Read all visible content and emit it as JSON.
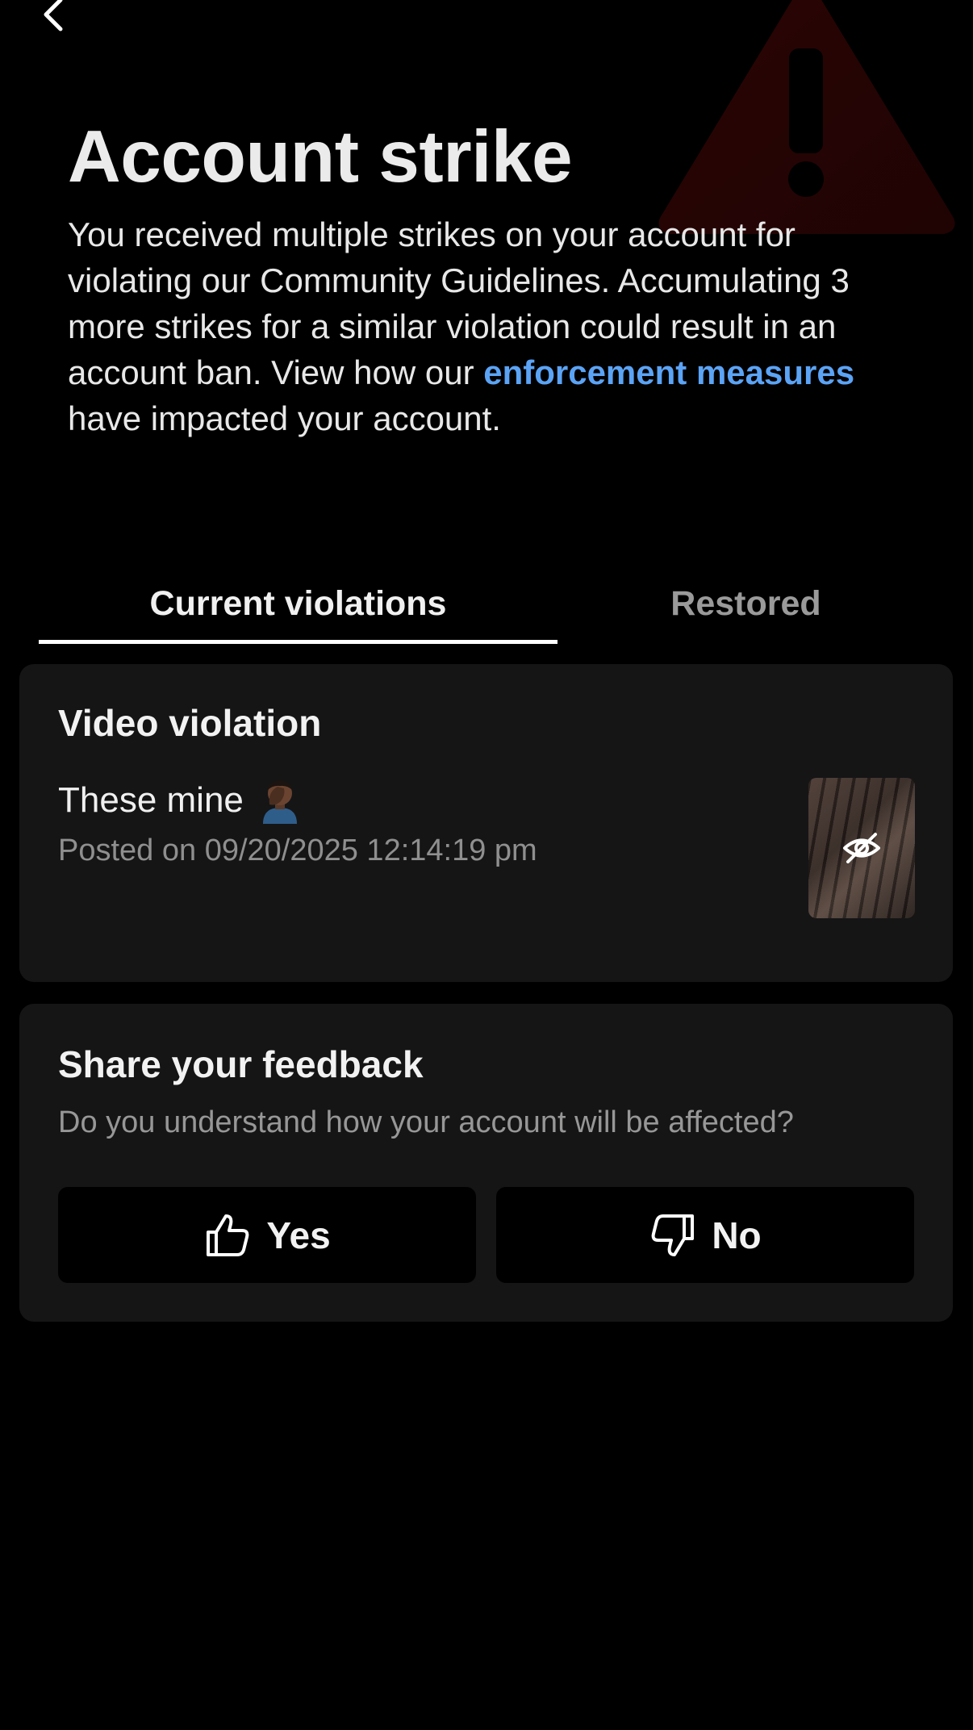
{
  "header": {
    "title": "Account strike"
  },
  "description": {
    "text_before_link": "You received multiple strikes on your account for violating our Community Guidelines. Accumulating 3 more strikes for a similar violation could result in an account ban. View how our ",
    "link_text": "enforcement measures",
    "text_after_link": " have impacted your account.",
    "link_color": "#5ba3f5"
  },
  "tabs": [
    {
      "label": "Current violations",
      "active": true
    },
    {
      "label": "Restored",
      "active": false
    }
  ],
  "violation": {
    "title": "Video violation",
    "caption": "These mine",
    "caption_emoji": "person-facepalming-emoji",
    "posted": "Posted on 09/20/2025 12:14:19 pm",
    "thumbnail_icon": "eye-slash-icon"
  },
  "feedback": {
    "title": "Share your feedback",
    "question": "Do you understand how your account will be affected?",
    "yes_label": "Yes",
    "no_label": "No",
    "yes_icon": "thumbs-up-icon",
    "no_icon": "thumbs-down-icon"
  },
  "colors": {
    "background": "#000000",
    "card": "#151516",
    "warning_accent": "#5a0a0a"
  },
  "icons": {
    "back": "chevron-left-icon",
    "background_graphic": "warning-triangle-icon"
  }
}
